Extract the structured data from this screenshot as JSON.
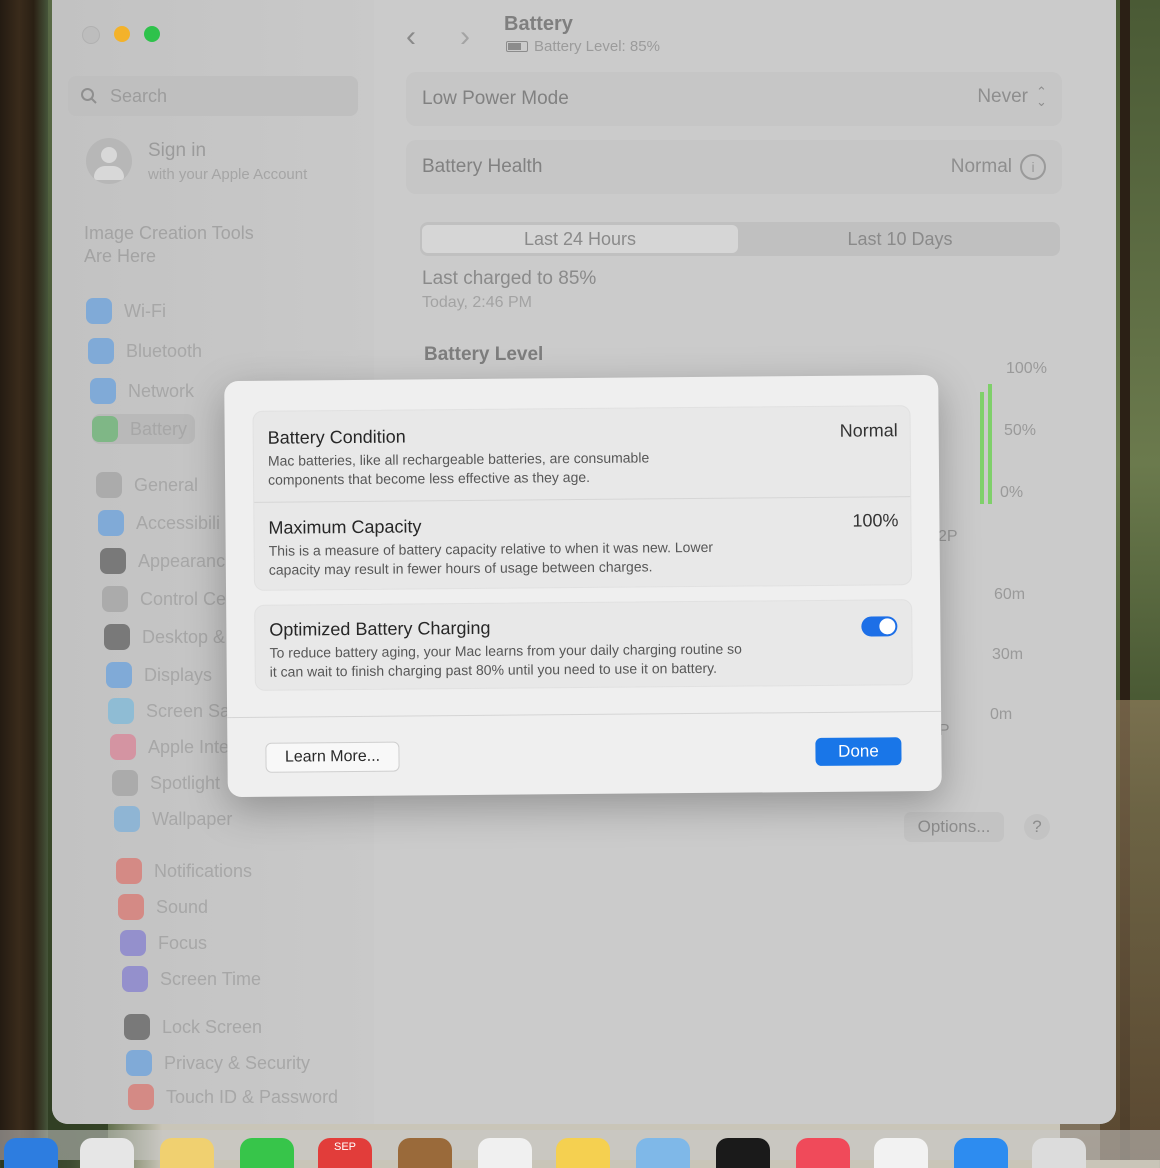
{
  "window": {
    "search_placeholder": "Search",
    "account": {
      "title": "Sign in",
      "subtitle": "with your Apple Account"
    },
    "promo": {
      "line1": "Image Creation Tools",
      "line2": "Are Here"
    },
    "sidebar": {
      "items": [
        {
          "label": "Wi-Fi",
          "icon": "wifi-icon",
          "color": "#2f8cf0"
        },
        {
          "label": "Bluetooth",
          "icon": "bluetooth-icon",
          "color": "#2f8cf0"
        },
        {
          "label": "Network",
          "icon": "globe-icon",
          "color": "#2f8cf0"
        },
        {
          "label": "Battery",
          "icon": "battery-icon",
          "color": "#3ab54a"
        },
        {
          "label": "General",
          "icon": "gear-icon",
          "color": "#8e8e8e"
        },
        {
          "label": "Accessibili",
          "icon": "accessibility-icon",
          "color": "#2f8cf0"
        },
        {
          "label": "Appearanc",
          "icon": "appearance-icon",
          "color": "#1f1f1f"
        },
        {
          "label": "Control Ce",
          "icon": "control-center-icon",
          "color": "#8e8e8e"
        },
        {
          "label": "Desktop &",
          "icon": "desktop-icon",
          "color": "#1f1f1f"
        },
        {
          "label": "Displays",
          "icon": "displays-icon",
          "color": "#2f8cf0"
        },
        {
          "label": "Screen Sav",
          "icon": "screensaver-icon",
          "color": "#4fb4e8"
        },
        {
          "label": "Apple Intel",
          "icon": "apple-intelligence-icon",
          "color": "#e85a7a"
        },
        {
          "label": "Spotlight",
          "icon": "spotlight-icon",
          "color": "#8e8e8e"
        },
        {
          "label": "Wallpaper",
          "icon": "wallpaper-icon",
          "color": "#4fa5e8"
        },
        {
          "label": "Notifications",
          "icon": "notifications-icon",
          "color": "#e8443a"
        },
        {
          "label": "Sound",
          "icon": "sound-icon",
          "color": "#e8443a"
        },
        {
          "label": "Focus",
          "icon": "focus-icon",
          "color": "#5a52d8"
        },
        {
          "label": "Screen Time",
          "icon": "screen-time-icon",
          "color": "#5a52d8"
        },
        {
          "label": "Lock Screen",
          "icon": "lock-screen-icon",
          "color": "#1f1f1f"
        },
        {
          "label": "Privacy & Security",
          "icon": "privacy-icon",
          "color": "#2f8cf0"
        },
        {
          "label": "Touch ID & Password",
          "icon": "touchid-icon",
          "color": "#e8443a"
        }
      ]
    },
    "main": {
      "title": "Battery",
      "subtitle": "Battery Level: 85%",
      "low_power_label": "Low Power Mode",
      "low_power_value": "Never",
      "health_label": "Battery Health",
      "health_value": "Normal",
      "tab_24h": "Last 24 Hours",
      "tab_10d": "Last 10 Days",
      "last_charged": "Last charged to 85%",
      "last_charged_time": "Today, 2:46 PM",
      "battery_level_title": "Battery Level",
      "axis": {
        "pct_100": "100%",
        "pct_50": "50%",
        "pct_0": "0%",
        "time_60": "60m",
        "time_30": "30m",
        "time_0": "0m",
        "tick_a": "2P",
        "tick_b": "2P"
      },
      "options_label": "Options...",
      "help_label": "?"
    }
  },
  "sheet": {
    "condition_title": "Battery Condition",
    "condition_value": "Normal",
    "condition_desc_1": "Mac batteries, like all rechargeable batteries, are consumable",
    "condition_desc_2": "components that become less effective as they age.",
    "capacity_title": "Maximum Capacity",
    "capacity_value": "100%",
    "capacity_desc_1": "This is a measure of battery capacity relative to when it was new. Lower",
    "capacity_desc_2": "capacity may result in fewer hours of usage between charges.",
    "optimized_title": "Optimized Battery Charging",
    "optimized_desc_1": "To reduce battery aging, your Mac learns from your daily charging routine so",
    "optimized_desc_2": "it can wait to finish charging past 80% until you need to use it on battery.",
    "learn_more": "Learn More...",
    "done": "Done"
  },
  "dock": {
    "calendar_month": "SEP"
  }
}
